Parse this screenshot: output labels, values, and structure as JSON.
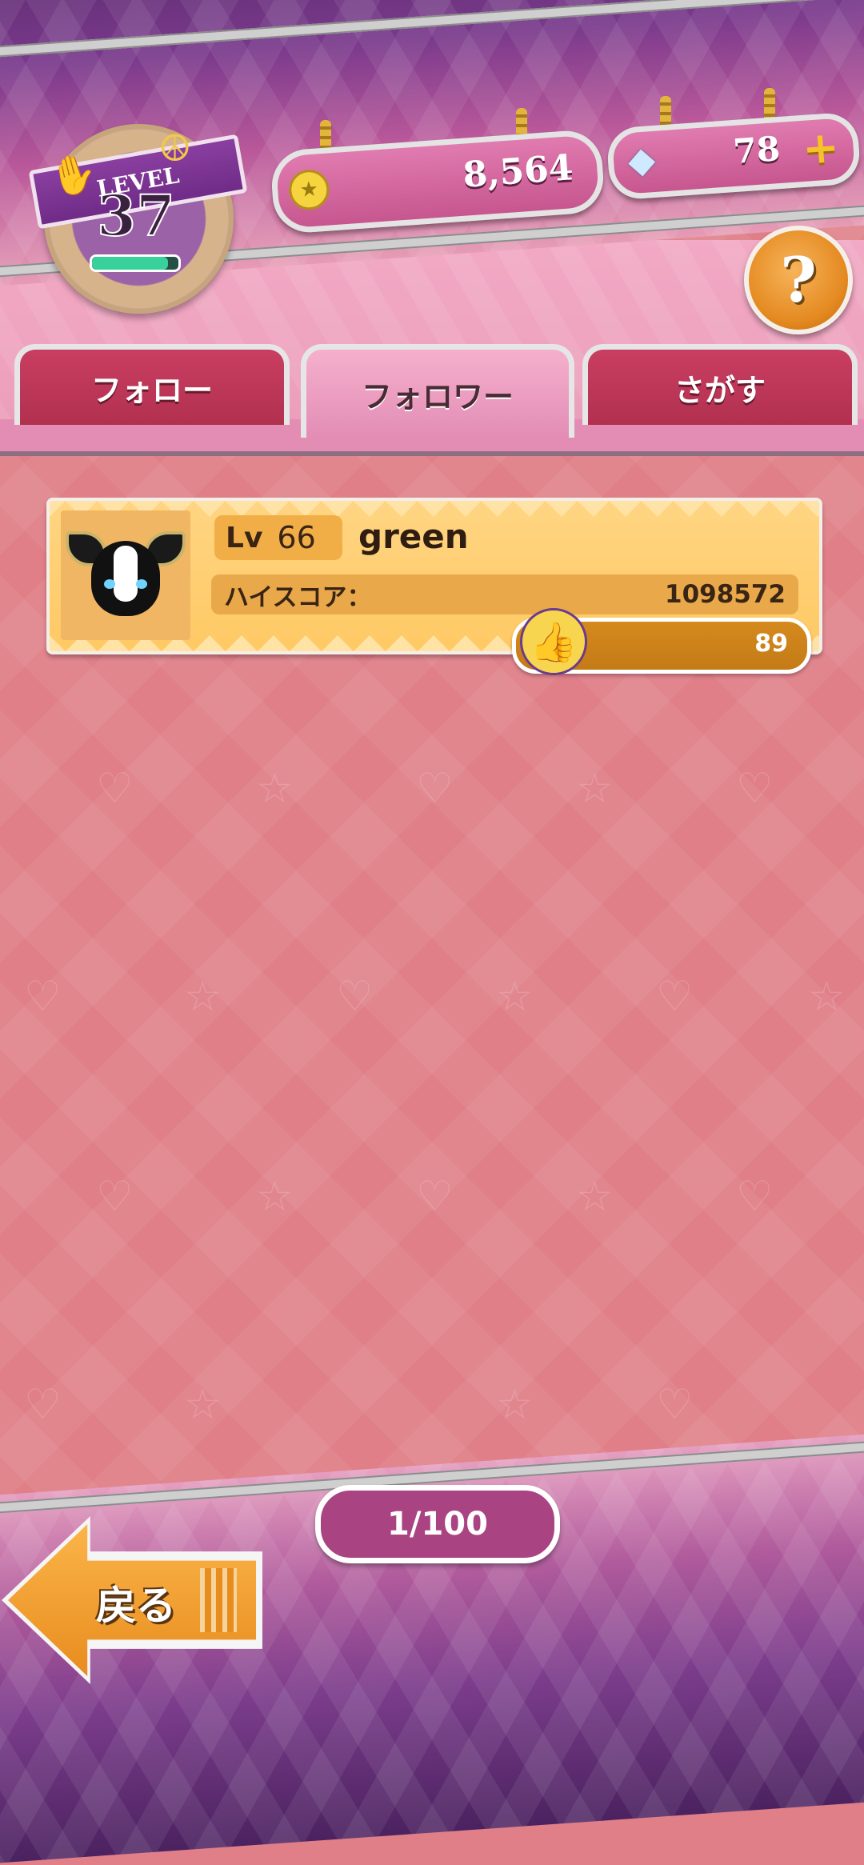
{
  "header": {
    "level": {
      "label": "LEVEL",
      "value": "37",
      "progress": 0.88
    },
    "coins": {
      "value": "8,564"
    },
    "gems": {
      "value": "78",
      "add_label": "+"
    },
    "help_label": "?"
  },
  "tabs": [
    {
      "label": "フォロー",
      "active": false
    },
    {
      "label": "フォロワー",
      "active": true
    },
    {
      "label": "さがす",
      "active": false
    }
  ],
  "followers": [
    {
      "level_prefix": "Lv",
      "level": "66",
      "name": "green",
      "high_score_label": "ハイスコア：",
      "high_score": "1098572",
      "likes": "89"
    }
  ],
  "pagination": {
    "text": "1/100"
  },
  "back_button": {
    "label": "戻る"
  },
  "colors": {
    "background": "#e07f88",
    "accent_purple": "#7a3a8c",
    "tab_inactive": "#c93e62",
    "card": "#ffd583",
    "like_bar": "#d48a1d"
  }
}
